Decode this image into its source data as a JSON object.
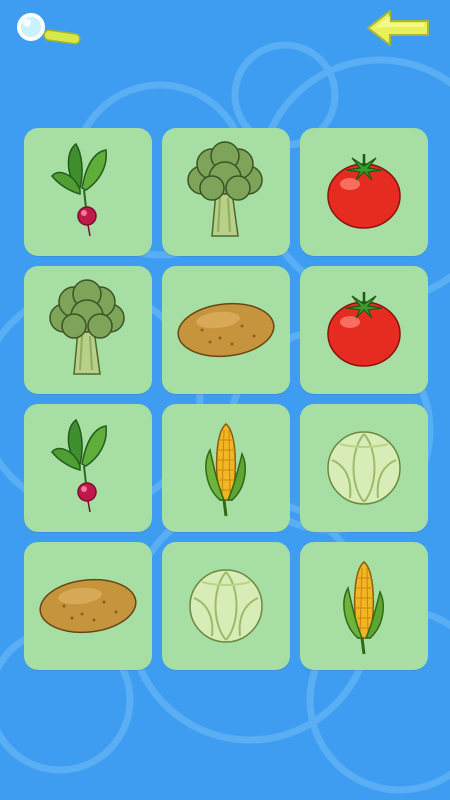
{
  "game": {
    "colors": {
      "background": "#3f9df1",
      "card": "#a6dea3",
      "tomato": "#e62c20",
      "broccoli": "#7ea45a",
      "potato": "#c5943d",
      "corn": "#f2b624",
      "cabbage": "#d8ecb7",
      "radish": "#c0184a"
    },
    "toolbar": {
      "search_icon": "magnifier-icon",
      "back_icon": "back-arrow-icon"
    },
    "cards": [
      {
        "item": "radish"
      },
      {
        "item": "broccoli"
      },
      {
        "item": "tomato"
      },
      {
        "item": "broccoli"
      },
      {
        "item": "potato"
      },
      {
        "item": "tomato"
      },
      {
        "item": "radish"
      },
      {
        "item": "corn"
      },
      {
        "item": "cabbage"
      },
      {
        "item": "potato"
      },
      {
        "item": "cabbage"
      },
      {
        "item": "corn"
      }
    ]
  }
}
